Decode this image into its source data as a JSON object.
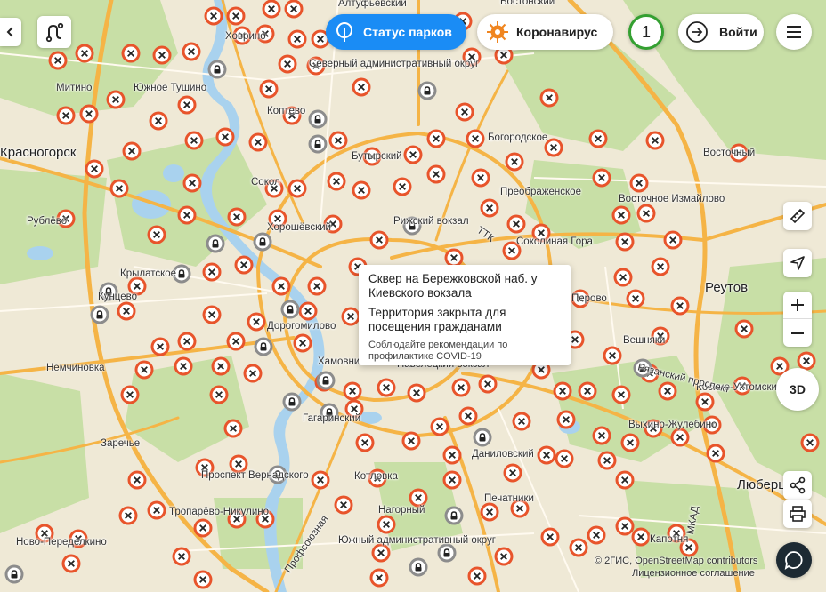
{
  "header": {
    "park_status_label": "Статус парков",
    "corona_label": "Коронавирус",
    "notifications_count": "1",
    "login_label": "Войти"
  },
  "popup": {
    "title": "Сквер на Бережковской наб. у Киевского вокзала",
    "status": "Территория закрыта для посещения гражданами",
    "note": "Соблюдайте рекомендации по профилактике COVID-19"
  },
  "map_controls": {
    "threed_label": "3D"
  },
  "attribution": {
    "line1": "© 2ГИС, OpenStreetMap contributors",
    "line2": "Лицензионное соглашение"
  },
  "map_labels": [
    "Алтуфьевский",
    "Бостонский",
    "Ховрино",
    "Северный административный округ",
    "Митино",
    "Южное Тушино",
    "Красногорск",
    "Коптево",
    "Богородское",
    "Восточный",
    "Бутырский",
    "Сокол",
    "Преображенское",
    "Восточное Измайлово",
    "Рублёво",
    "Хорошёвский",
    "Рижский вокзал",
    "Крылатское",
    "ТТК",
    "Соколиная Гора",
    "Реутов",
    "Кунцево",
    "Перово",
    "Дорогомилово",
    "Немчиновка",
    "Хамовники",
    "Павелецкий вокзал",
    "Вешняки",
    "Косино-Ухтомский",
    "Гагаринский",
    "Рязанский проспект",
    "Выхино-Жулебино",
    "Заречье",
    "Проспект Вернадского",
    "Даниловский",
    "Люберцы",
    "Котловка",
    "Печатники",
    "Тропарёво-Никулино",
    "Нагорный",
    "Южный административный округ",
    "Капотня",
    "Ново-Переделкино",
    "Профсоюзная",
    "МКАД"
  ],
  "marker_legend": {
    "closed": "территория закрыта",
    "open": "территория открыта"
  },
  "colors": {
    "park_status_bg": "#1a8cf5",
    "closed_marker": "#e8542b",
    "open_marker": "#8c8c8c",
    "notification_ring": "#34a031",
    "road_major": "#f6b547",
    "park_green": "#c6dea4",
    "water": "#aad3ef"
  }
}
